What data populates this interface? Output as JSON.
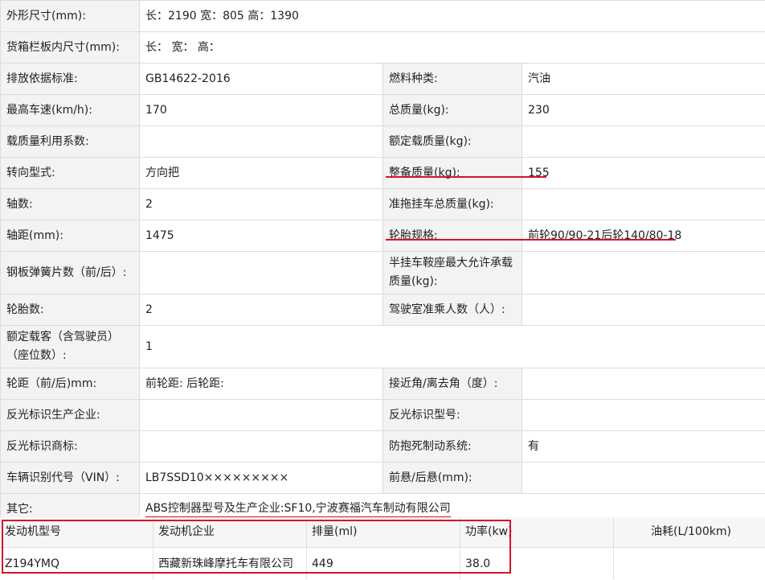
{
  "rows": [
    {
      "label": "外形尺寸(mm):",
      "value": "长：2190 宽：805 高：1390"
    },
    {
      "label": "货箱栏板内尺寸(mm):",
      "value": "长： 宽： 高："
    },
    {
      "label": "排放依据标准:",
      "value": "GB14622-2016",
      "label2": "燃料种类:",
      "value2": "汽油"
    },
    {
      "label": "最高车速(km/h):",
      "value": "170",
      "label2": "总质量(kg):",
      "value2": "230"
    },
    {
      "label": "载质量利用系数:",
      "value": "",
      "label2": "额定载质量(kg):",
      "value2": ""
    },
    {
      "label": "转向型式:",
      "value": "方向把",
      "label2": "整备质量(kg):",
      "value2": "155"
    },
    {
      "label": "轴数:",
      "value": "2",
      "label2": "准拖挂车总质量(kg):",
      "value2": ""
    },
    {
      "label": "轴距(mm):",
      "value": "1475",
      "label2": "轮胎规格:",
      "value2": "前轮90/90-21后轮140/80-18"
    },
    {
      "label": "钢板弹簧片数（前/后）:",
      "value": "",
      "label2": "半挂车鞍座最大允许承载质量(kg):",
      "value2": ""
    },
    {
      "label": "轮胎数:",
      "value": "2",
      "label2": "驾驶室准乘人数（人）:",
      "value2": ""
    },
    {
      "label": "额定载客（含驾驶员）（座位数）:",
      "value": "1"
    },
    {
      "label": "轮距（前/后)mm:",
      "value": "前轮距: 后轮距:",
      "label2": "接近角/离去角（度）:",
      "value2": ""
    },
    {
      "label": "反光标识生产企业:",
      "value": "",
      "label2": "反光标识型号:",
      "value2": ""
    },
    {
      "label": "反光标识商标:",
      "value": "",
      "label2": "防抱死制动系统:",
      "value2": "有"
    },
    {
      "label": "车辆识别代号（VIN）:",
      "value": "LB7SSD10×××××××××",
      "label2": "前悬/后悬(mm):",
      "value2": ""
    },
    {
      "label": "其它:",
      "value": "ABS控制器型号及生产企业:SF10,宁波赛福汽车制动有限公司"
    }
  ],
  "engine": {
    "headers": [
      "发动机型号",
      "发动机企业",
      "排量(ml)",
      "功率(kw)",
      "油耗(L/100km)"
    ],
    "values": [
      "Z194YMQ",
      "西藏新珠峰摩托车有限公司",
      "449",
      "38.0",
      ""
    ]
  },
  "highlight_color": "#d9112a"
}
